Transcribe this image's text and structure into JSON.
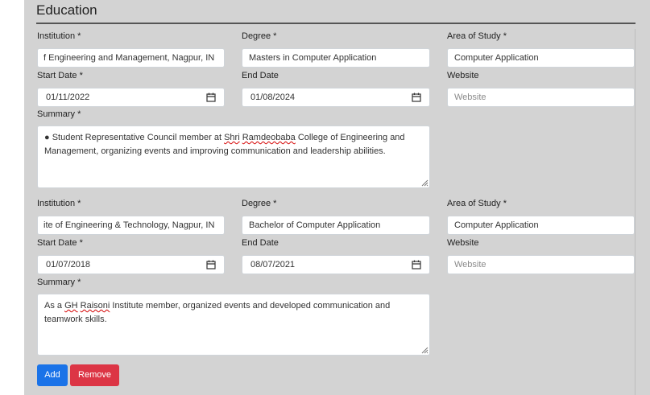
{
  "section": {
    "title": "Education"
  },
  "labels": {
    "institution": "Institution *",
    "degree": "Degree *",
    "area": "Area of Study *",
    "start": "Start Date *",
    "end": "End Date",
    "website": "Website",
    "summary": "Summary *"
  },
  "entries": [
    {
      "institution": "f Engineering and Management, Nagpur, IN",
      "degree": "Masters in Computer Application",
      "area": "Computer Application",
      "start_date": "01/11/2022",
      "end_date": "01/08/2024",
      "website_placeholder": "Website",
      "summary_prefix": "● Student Representative Council member at ",
      "summary_flag1": "Shri",
      "summary_mid": " ",
      "summary_flag2": "Ramdeobaba",
      "summary_suffix": " College of Engineering and Management, organizing events and improving communication and leadership abilities."
    },
    {
      "institution": "ite of Engineering & Technology, Nagpur, IN",
      "degree": "Bachelor of Computer Application",
      "area": "Computer Application",
      "start_date": "01/07/2018",
      "end_date": "08/07/2021",
      "website_placeholder": "Website",
      "summary_prefix": "As a ",
      "summary_flag1": "GH",
      "summary_mid": " ",
      "summary_flag2": "Raisoni",
      "summary_suffix": " Institute member, organized events and developed communication and teamwork skills."
    }
  ],
  "buttons": {
    "add": "Add",
    "remove": "Remove"
  },
  "colors": {
    "add": "#1a73e8",
    "remove": "#dc3545",
    "panel": "#d3d3d3"
  },
  "icons": {
    "date": "calendar-icon",
    "resize": "resize-handle-icon"
  }
}
